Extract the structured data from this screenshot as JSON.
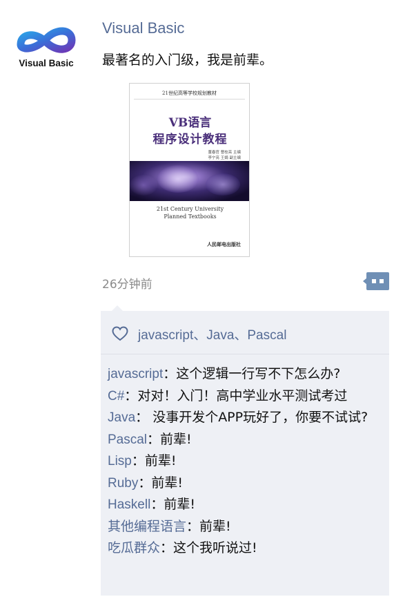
{
  "post": {
    "avatar_label": "Visual Basic",
    "username": "Visual Basic",
    "text": "最著名的入门级，我是前辈。",
    "image": {
      "series": "21世纪高等学校规划教材",
      "title_line1": "VB语言",
      "title_line2": "程序设计教程",
      "authors_line1": "董春官 曹桂亮 主编",
      "authors_line2": "李宁亮 王娟 副主编",
      "english_line1": "21st Century University",
      "english_line2": "Planned Textbooks",
      "publisher": "人民邮电出版社"
    },
    "time": "26分钟前"
  },
  "likes": {
    "names": "javascript、Java、Pascal"
  },
  "comments": [
    {
      "author": "javascript",
      "text": "这个逻辑一行写不下怎么办?"
    },
    {
      "author": "C#",
      "text": "对对！入门！高中学业水平测试考过"
    },
    {
      "author": "Java",
      "text": "没事开发个APP玩好了，你要不试试?"
    },
    {
      "author": "Pascal",
      "text": "前辈!"
    },
    {
      "author": "Lisp",
      "text": "前辈!"
    },
    {
      "author": "Ruby",
      "text": "前辈!"
    },
    {
      "author": "Haskell",
      "text": "前辈!"
    },
    {
      "author": "其他编程语言",
      "text": "前辈!"
    },
    {
      "author": "吃瓜群众",
      "text": "这个我听说过!"
    }
  ],
  "colors": {
    "link": "#556b95",
    "panel": "#eef0f5",
    "comment_button": "#6f8fb5"
  }
}
